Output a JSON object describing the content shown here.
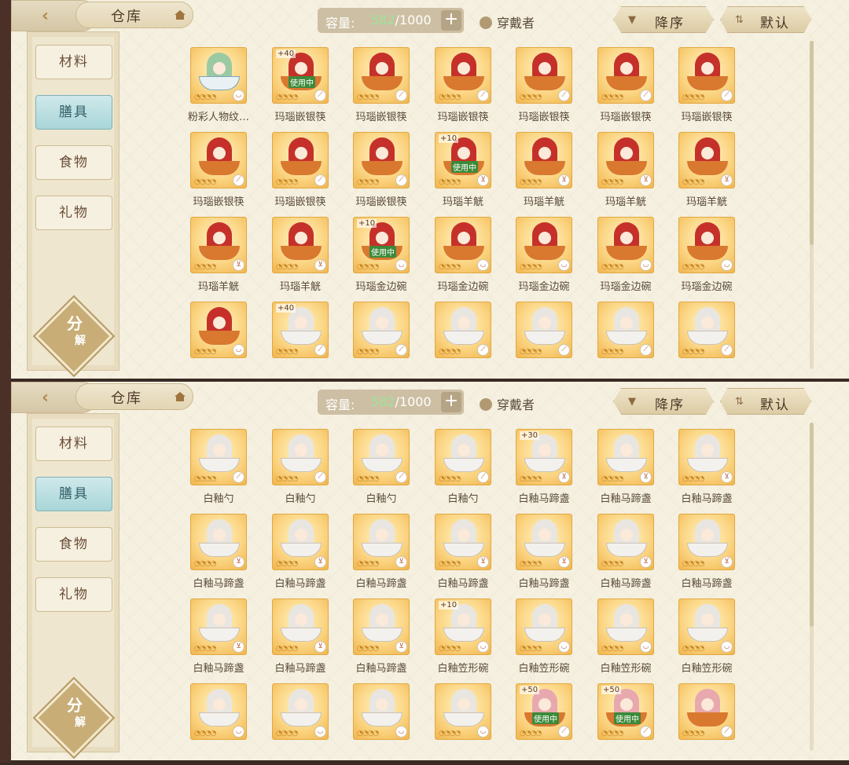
{
  "panels": [
    {
      "header": {
        "title": "仓库",
        "capacity_label": "容量:",
        "capacity_used": "582",
        "capacity_total": "/1000",
        "add": "+",
        "wearer_label": "穿戴者",
        "sort_label": "降序",
        "default_label": "默认"
      },
      "tabs": [
        "材料",
        "膳具",
        "食物",
        "礼物"
      ],
      "active_tab": 1,
      "decompose": [
        "分",
        "解"
      ],
      "items": [
        {
          "name": "粉彩人物纹…",
          "fig": "green",
          "dish": "blue",
          "badge": "◡"
        },
        {
          "name": "玛瑙嵌银筷",
          "fig": "red",
          "dish": "gold",
          "plus": "+40",
          "in_use": "使用中",
          "badge": "⟋"
        },
        {
          "name": "玛瑙嵌银筷",
          "fig": "red",
          "dish": "gold",
          "badge": "⟋"
        },
        {
          "name": "玛瑙嵌银筷",
          "fig": "red",
          "dish": "gold",
          "badge": "⟋"
        },
        {
          "name": "玛瑙嵌银筷",
          "fig": "red",
          "dish": "gold",
          "badge": "⟋"
        },
        {
          "name": "玛瑙嵌银筷",
          "fig": "red",
          "dish": "gold",
          "badge": "⟋"
        },
        {
          "name": "玛瑙嵌银筷",
          "fig": "red",
          "dish": "gold",
          "badge": "⟋"
        },
        {
          "name": "玛瑙嵌银筷",
          "fig": "red",
          "dish": "gold",
          "badge": "⟋"
        },
        {
          "name": "玛瑙嵌银筷",
          "fig": "red",
          "dish": "gold",
          "badge": "⟋"
        },
        {
          "name": "玛瑙嵌银筷",
          "fig": "red",
          "dish": "gold",
          "badge": "⟋"
        },
        {
          "name": "玛瑙羊觥",
          "fig": "red",
          "dish": "gold",
          "plus": "+10",
          "in_use": "使用中",
          "badge": "⊻"
        },
        {
          "name": "玛瑙羊觥",
          "fig": "red",
          "dish": "gold",
          "badge": "⊻"
        },
        {
          "name": "玛瑙羊觥",
          "fig": "red",
          "dish": "gold",
          "badge": "⊻"
        },
        {
          "name": "玛瑙羊觥",
          "fig": "red",
          "dish": "gold",
          "badge": "⊻"
        },
        {
          "name": "玛瑙羊觥",
          "fig": "red",
          "dish": "gold",
          "badge": "⊻"
        },
        {
          "name": "玛瑙羊觥",
          "fig": "red",
          "dish": "gold",
          "badge": "⊻"
        },
        {
          "name": "玛瑙金边碗",
          "fig": "red",
          "dish": "gold",
          "plus": "+10",
          "in_use": "使用中",
          "badge": "◡"
        },
        {
          "name": "玛瑙金边碗",
          "fig": "red",
          "dish": "gold",
          "badge": "◡"
        },
        {
          "name": "玛瑙金边碗",
          "fig": "red",
          "dish": "gold",
          "badge": "◡"
        },
        {
          "name": "玛瑙金边碗",
          "fig": "red",
          "dish": "gold",
          "badge": "◡"
        },
        {
          "name": "玛瑙金边碗",
          "fig": "red",
          "dish": "gold",
          "badge": "◡"
        },
        {
          "name": "",
          "fig": "red",
          "dish": "gold",
          "badge": "◡"
        },
        {
          "name": "",
          "fig": "white",
          "dish": "silver",
          "plus": "+40",
          "badge": "⟋"
        },
        {
          "name": "",
          "fig": "white",
          "dish": "silver",
          "badge": "⟋"
        },
        {
          "name": "",
          "fig": "white",
          "dish": "silver",
          "badge": "⟋"
        },
        {
          "name": "",
          "fig": "white",
          "dish": "silver",
          "badge": "⟋"
        },
        {
          "name": "",
          "fig": "white",
          "dish": "silver",
          "badge": "⟋"
        },
        {
          "name": "",
          "fig": "white",
          "dish": "silver",
          "badge": "⟋"
        }
      ]
    },
    {
      "header": {
        "title": "仓库",
        "capacity_label": "容量:",
        "capacity_used": "582",
        "capacity_total": "/1000",
        "add": "+",
        "wearer_label": "穿戴者",
        "sort_label": "降序",
        "default_label": "默认"
      },
      "tabs": [
        "材料",
        "膳具",
        "食物",
        "礼物"
      ],
      "active_tab": 1,
      "decompose": [
        "分",
        "解"
      ],
      "items": [
        {
          "name": "白釉勺",
          "fig": "white",
          "dish": "silver",
          "badge": "⟋"
        },
        {
          "name": "白釉勺",
          "fig": "white",
          "dish": "silver",
          "badge": "⟋"
        },
        {
          "name": "白釉勺",
          "fig": "white",
          "dish": "silver",
          "badge": "⟋"
        },
        {
          "name": "白釉勺",
          "fig": "white",
          "dish": "silver",
          "badge": "⟋"
        },
        {
          "name": "白釉马蹄盏",
          "fig": "white",
          "dish": "silver",
          "plus": "+30",
          "badge": "⊻"
        },
        {
          "name": "白釉马蹄盏",
          "fig": "white",
          "dish": "silver",
          "badge": "⊻"
        },
        {
          "name": "白釉马蹄盏",
          "fig": "white",
          "dish": "silver",
          "badge": "⊻"
        },
        {
          "name": "白釉马蹄盏",
          "fig": "white",
          "dish": "silver",
          "badge": "⊻"
        },
        {
          "name": "白釉马蹄盏",
          "fig": "white",
          "dish": "silver",
          "badge": "⊻"
        },
        {
          "name": "白釉马蹄盏",
          "fig": "white",
          "dish": "silver",
          "badge": "⊻"
        },
        {
          "name": "白釉马蹄盏",
          "fig": "white",
          "dish": "silver",
          "badge": "⊻"
        },
        {
          "name": "白釉马蹄盏",
          "fig": "white",
          "dish": "silver",
          "badge": "⊻"
        },
        {
          "name": "白釉马蹄盏",
          "fig": "white",
          "dish": "silver",
          "badge": "⊻"
        },
        {
          "name": "白釉马蹄盏",
          "fig": "white",
          "dish": "silver",
          "badge": "⊻"
        },
        {
          "name": "白釉马蹄盏",
          "fig": "white",
          "dish": "silver",
          "badge": "⊻"
        },
        {
          "name": "白釉马蹄盏",
          "fig": "white",
          "dish": "silver",
          "badge": "⊻"
        },
        {
          "name": "白釉马蹄盏",
          "fig": "white",
          "dish": "silver",
          "badge": "⊻"
        },
        {
          "name": "白釉笠形碗",
          "fig": "white",
          "dish": "silver",
          "plus": "+10",
          "badge": "◡"
        },
        {
          "name": "白釉笠形碗",
          "fig": "white",
          "dish": "silver",
          "badge": "◡"
        },
        {
          "name": "白釉笠形碗",
          "fig": "white",
          "dish": "silver",
          "badge": "◡"
        },
        {
          "name": "白釉笠形碗",
          "fig": "white",
          "dish": "silver",
          "badge": "◡"
        },
        {
          "name": "",
          "fig": "white",
          "dish": "silver",
          "badge": "◡"
        },
        {
          "name": "",
          "fig": "white",
          "dish": "silver",
          "badge": "◡"
        },
        {
          "name": "",
          "fig": "white",
          "dish": "silver",
          "badge": "◡"
        },
        {
          "name": "",
          "fig": "white",
          "dish": "silver",
          "badge": "◡"
        },
        {
          "name": "",
          "fig": "pink",
          "dish": "gold",
          "plus": "+50",
          "in_use": "使用中",
          "badge": "⟋"
        },
        {
          "name": "",
          "fig": "pink",
          "dish": "gold",
          "plus": "+50",
          "in_use": "使用中",
          "badge": "⟋"
        },
        {
          "name": "",
          "fig": "pink",
          "dish": "gold",
          "badge": "⟋"
        }
      ]
    }
  ]
}
